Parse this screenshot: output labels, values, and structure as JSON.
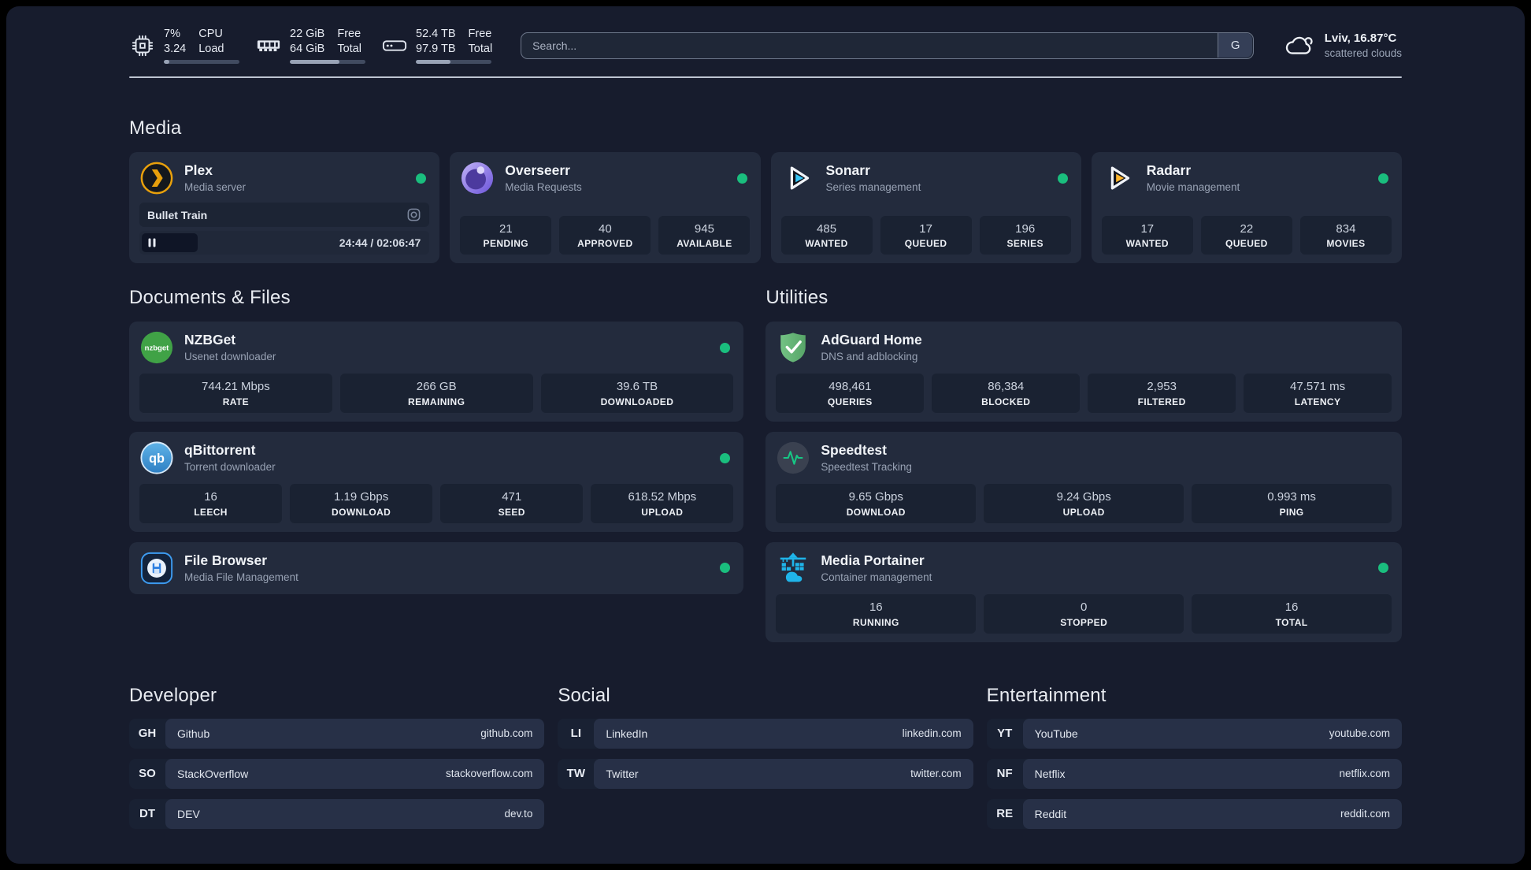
{
  "colors": {
    "status_online": "#1abe7e",
    "background": "#171c2d",
    "card": "#232b3d",
    "plex_gold": "#e8a00c",
    "sonarr_blue": "#35c4f4",
    "radarr_yellow": "#ffb62e",
    "progress_fill": "#99a3b6"
  },
  "header": {
    "system": [
      {
        "name": "cpu",
        "icon": "cpu-icon",
        "col1": [
          "7%",
          "3.24"
        ],
        "col2": [
          "CPU",
          "Load"
        ],
        "progress": 7
      },
      {
        "name": "memory",
        "icon": "memory-icon",
        "col1": [
          "22 GiB",
          "64 GiB"
        ],
        "col2": [
          "Free",
          "Total"
        ],
        "progress": 66
      },
      {
        "name": "disk",
        "icon": "disk-icon",
        "col1": [
          "52.4 TB",
          "97.9 TB"
        ],
        "col2": [
          "Free",
          "Total"
        ],
        "progress": 46
      }
    ],
    "search": {
      "placeholder": "Search...",
      "button_label": "G"
    },
    "weather": {
      "icon": "cloud-icon",
      "location": "Lviv, 16.87°C",
      "condition": "scattered clouds"
    }
  },
  "sections": {
    "media": {
      "title": "Media",
      "cards": [
        {
          "icon": "plex-logo",
          "title": "Plex",
          "subtitle": "Media server",
          "online": true,
          "player": {
            "track": "Bullet Train",
            "elapsed": "24:44",
            "duration": "02:06:47",
            "progress_pct": 19.5,
            "icon_pause": "pause-icon",
            "icon_camera": "camera-icon"
          }
        },
        {
          "icon": "overseerr-logo",
          "title": "Overseerr",
          "subtitle": "Media Requests",
          "online": true,
          "stats": [
            {
              "value": "21",
              "label": "PENDING"
            },
            {
              "value": "40",
              "label": "APPROVED"
            },
            {
              "value": "945",
              "label": "AVAILABLE"
            }
          ]
        },
        {
          "icon": "sonarr-logo",
          "title": "Sonarr",
          "subtitle": "Series management",
          "online": true,
          "stats": [
            {
              "value": "485",
              "label": "WANTED"
            },
            {
              "value": "17",
              "label": "QUEUED"
            },
            {
              "value": "196",
              "label": "SERIES"
            }
          ]
        },
        {
          "icon": "radarr-logo",
          "title": "Radarr",
          "subtitle": "Movie management",
          "online": true,
          "stats": [
            {
              "value": "17",
              "label": "WANTED"
            },
            {
              "value": "22",
              "label": "QUEUED"
            },
            {
              "value": "834",
              "label": "MOVIES"
            }
          ]
        }
      ]
    },
    "documents": {
      "title": "Documents & Files",
      "cards": [
        {
          "icon": "nzbget-logo",
          "title": "NZBGet",
          "subtitle": "Usenet downloader",
          "online": true,
          "stats": [
            {
              "value": "744.21 Mbps",
              "label": "RATE"
            },
            {
              "value": "266 GB",
              "label": "REMAINING"
            },
            {
              "value": "39.6 TB",
              "label": "DOWNLOADED"
            }
          ]
        },
        {
          "icon": "qbittorrent-logo",
          "title": "qBittorrent",
          "subtitle": "Torrent downloader",
          "online": true,
          "stats": [
            {
              "value": "16",
              "label": "LEECH"
            },
            {
              "value": "1.19 Gbps",
              "label": "DOWNLOAD"
            },
            {
              "value": "471",
              "label": "SEED"
            },
            {
              "value": "618.52 Mbps",
              "label": "UPLOAD"
            }
          ]
        },
        {
          "icon": "filebrowser-logo",
          "title": "File Browser",
          "subtitle": "Media File Management",
          "online": true
        }
      ]
    },
    "utilities": {
      "title": "Utilities",
      "cards": [
        {
          "icon": "adguard-logo",
          "title": "AdGuard Home",
          "subtitle": "DNS and adblocking",
          "online": false,
          "stats": [
            {
              "value": "498,461",
              "label": "QUERIES"
            },
            {
              "value": "86,384",
              "label": "BLOCKED"
            },
            {
              "value": "2,953",
              "label": "FILTERED"
            },
            {
              "value": "47.571 ms",
              "label": "LATENCY"
            }
          ]
        },
        {
          "icon": "speedtest-logo",
          "title": "Speedtest",
          "subtitle": "Speedtest Tracking",
          "online": false,
          "stats": [
            {
              "value": "9.65 Gbps",
              "label": "DOWNLOAD"
            },
            {
              "value": "9.24 Gbps",
              "label": "UPLOAD"
            },
            {
              "value": "0.993 ms",
              "label": "PING"
            }
          ]
        },
        {
          "icon": "portainer-logo",
          "title": "Media Portainer",
          "subtitle": "Container management",
          "online": true,
          "stats": [
            {
              "value": "16",
              "label": "RUNNING"
            },
            {
              "value": "0",
              "label": "STOPPED"
            },
            {
              "value": "16",
              "label": "TOTAL"
            }
          ]
        }
      ]
    },
    "bookmarks": [
      {
        "title": "Developer",
        "links": [
          {
            "abbr": "GH",
            "name": "Github",
            "url": "github.com"
          },
          {
            "abbr": "SO",
            "name": "StackOverflow",
            "url": "stackoverflow.com"
          },
          {
            "abbr": "DT",
            "name": "DEV",
            "url": "dev.to"
          }
        ]
      },
      {
        "title": "Social",
        "links": [
          {
            "abbr": "LI",
            "name": "LinkedIn",
            "url": "linkedin.com"
          },
          {
            "abbr": "TW",
            "name": "Twitter",
            "url": "twitter.com"
          }
        ]
      },
      {
        "title": "Entertainment",
        "links": [
          {
            "abbr": "YT",
            "name": "YouTube",
            "url": "youtube.com"
          },
          {
            "abbr": "NF",
            "name": "Netflix",
            "url": "netflix.com"
          },
          {
            "abbr": "RE",
            "name": "Reddit",
            "url": "reddit.com"
          }
        ]
      }
    ]
  }
}
